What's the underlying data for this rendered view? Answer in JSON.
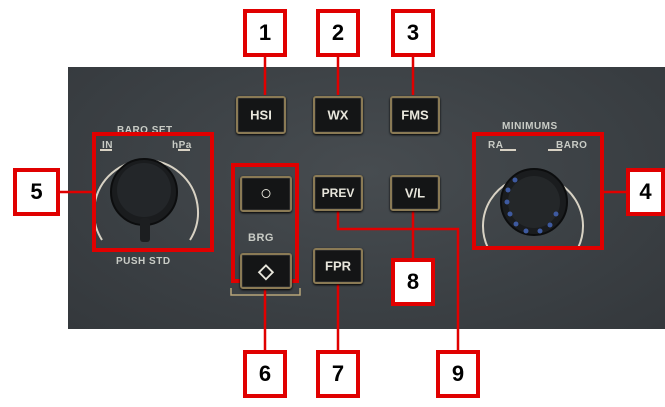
{
  "panel": {
    "baro_set": "BARO SET",
    "baro_in": "IN",
    "baro_hpa": "hPa",
    "push_std": "PUSH STD",
    "minimums": "MINIMUMS",
    "min_ra": "RA",
    "min_baro": "BARO",
    "brg": "BRG"
  },
  "buttons": {
    "hsi": "HSI",
    "wx": "WX",
    "fms": "FMS",
    "prev": "PREV",
    "vl": "V/L",
    "fpr": "FPR",
    "brg_circle": "○",
    "brg_diamond": "◇"
  },
  "callouts": [
    "1",
    "2",
    "3",
    "4",
    "5",
    "6",
    "7",
    "8",
    "9"
  ],
  "colors": {
    "callout_red": "#e00000",
    "panel_bg": "#3d4246",
    "button_border": "#8a7a55"
  }
}
